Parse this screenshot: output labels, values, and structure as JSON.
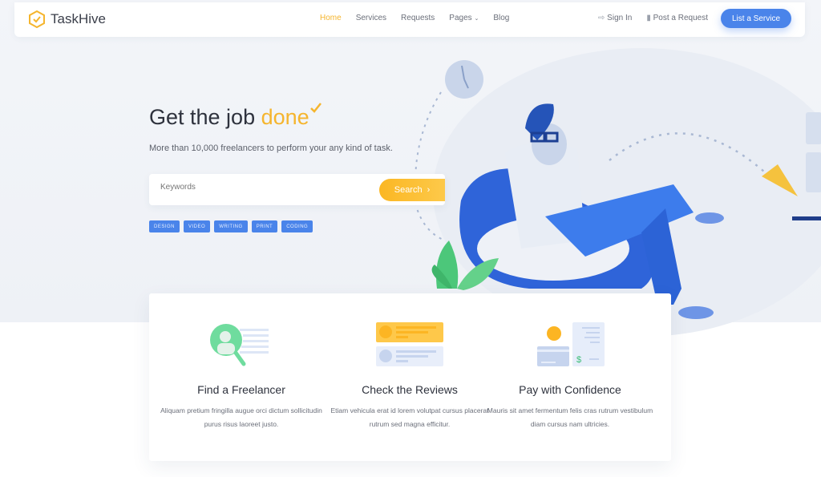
{
  "brand": {
    "name": "TaskHive",
    "accent": "#f5b52e",
    "primary": "#4a84ea"
  },
  "nav": {
    "items": [
      {
        "label": "Home",
        "active": true
      },
      {
        "label": "Services"
      },
      {
        "label": "Requests"
      },
      {
        "label": "Pages",
        "dropdown": true
      },
      {
        "label": "Blog"
      }
    ]
  },
  "header_right": {
    "signin": "Sign In",
    "post": "Post a Request",
    "cta": "List a Service"
  },
  "hero": {
    "title_prefix": "Get the job",
    "title_accent": "done",
    "subtitle": "More than 10,000 freelancers to perform your any kind of task.",
    "search_placeholder": "Keywords",
    "search_button": "Search",
    "tags": [
      "DESIGN",
      "VIDEO",
      "WRITING",
      "PRINT",
      "CODING"
    ]
  },
  "features": [
    {
      "title": "Find a Freelancer",
      "text": "Aliquam pretium fringilla augue orci dictum sollicitudin purus risus laoreet justo.",
      "icon": "search-person-icon"
    },
    {
      "title": "Check the Reviews",
      "text": "Etiam vehicula erat id lorem volutpat cursus placerat rutrum sed magna efficitur.",
      "icon": "reviews-icon"
    },
    {
      "title": "Pay with Confidence",
      "text": "Mauris sit amet fermentum felis cras rutrum vestibulum diam cursus nam ultricies.",
      "icon": "payment-icon"
    }
  ]
}
